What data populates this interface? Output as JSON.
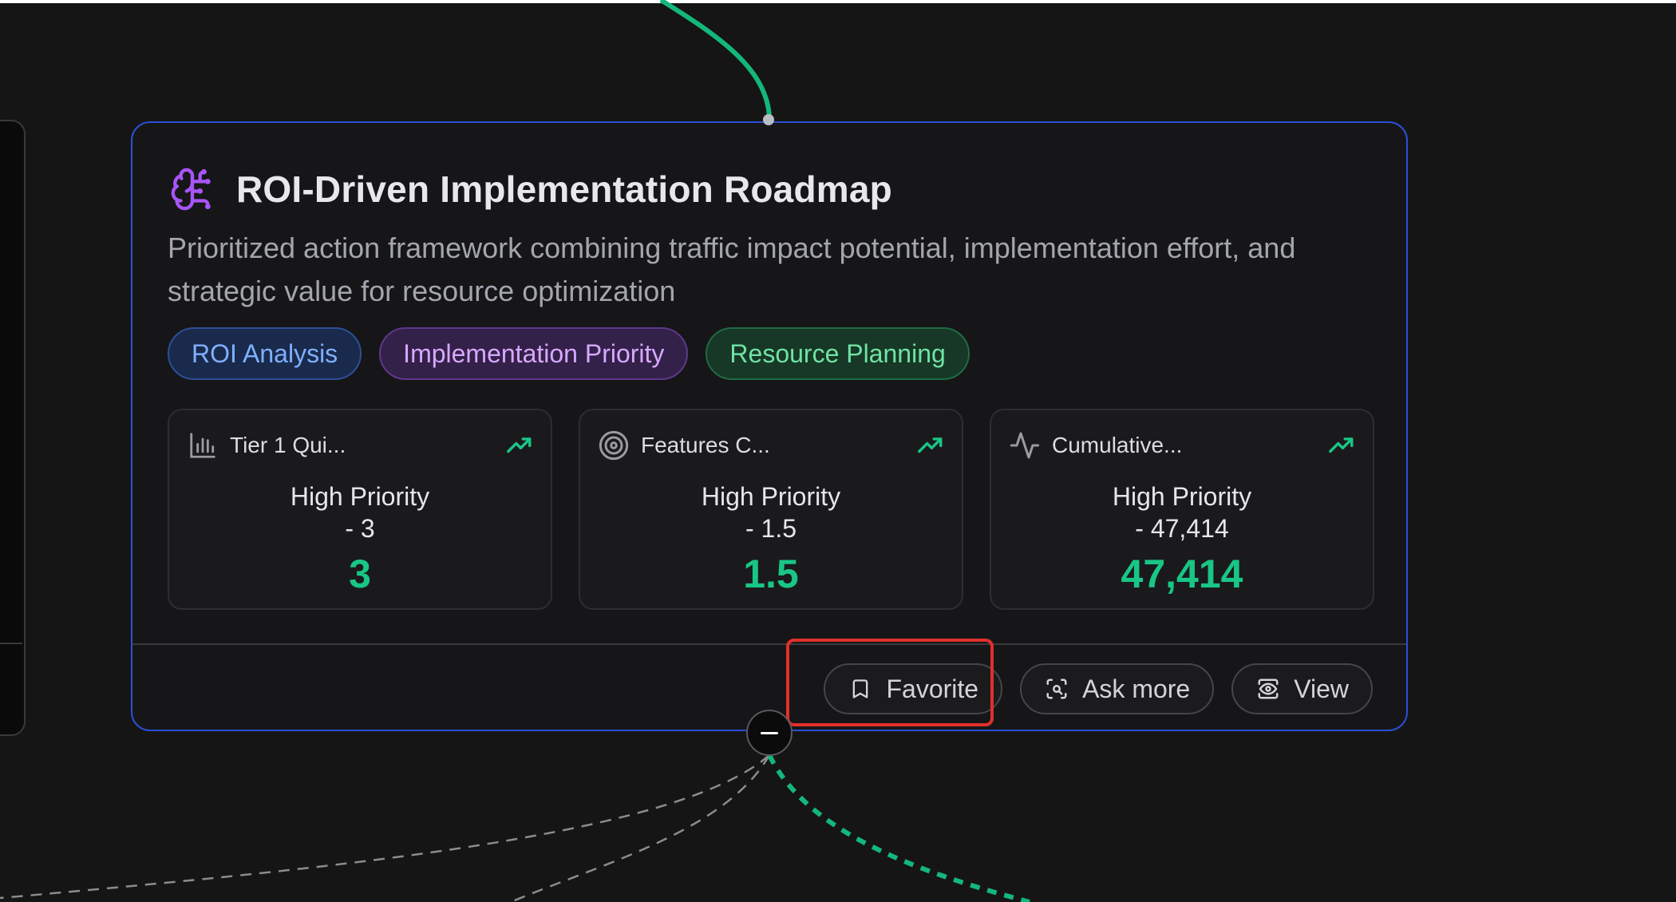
{
  "card": {
    "title": "ROI-Driven Implementation Roadmap",
    "description": "Prioritized action framework combining traffic impact potential, implementation effort, and strategic value for resource optimization",
    "title_icon": "brain-icon",
    "tags": [
      {
        "label": "ROI Analysis",
        "color": "#7fb0ff"
      },
      {
        "label": "Implementation Priority",
        "color": "#d9a8ff"
      },
      {
        "label": "Resource Planning",
        "color": "#6fe3a4"
      }
    ],
    "metrics": [
      {
        "icon": "bar-chart-icon",
        "label": "Tier 1 Qui...",
        "body_line1": "High Priority",
        "body_line2": "- 3",
        "value": "3"
      },
      {
        "icon": "target-icon",
        "label": "Features C...",
        "body_line1": "High Priority",
        "body_line2": "- 1.5",
        "value": "1.5"
      },
      {
        "icon": "activity-icon",
        "label": "Cumulative...",
        "body_line1": "High Priority",
        "body_line2": "- 47,414",
        "value": "47,414"
      }
    ],
    "actions": {
      "favorite": "Favorite",
      "ask_more": "Ask more",
      "view": "View"
    }
  },
  "colors": {
    "card_border": "#2b4fd6",
    "metric_value": "#19c685",
    "edge_green": "#14b77a",
    "annotation_red": "#e1302b"
  }
}
